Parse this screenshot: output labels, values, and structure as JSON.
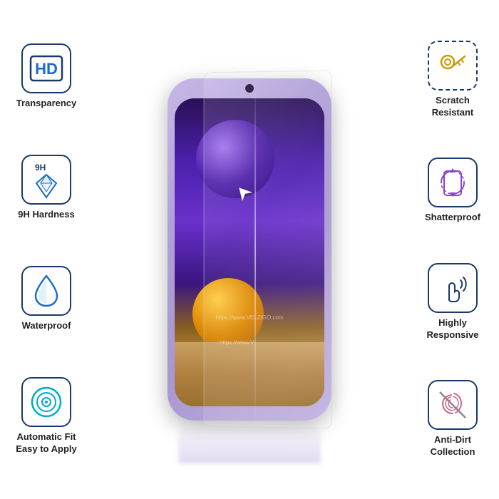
{
  "features": {
    "left": [
      {
        "id": "hd-transparency",
        "label": "Transparency",
        "icon": "hd",
        "sublabel": ""
      },
      {
        "id": "9h-hardness",
        "label": "9H Hardness",
        "icon": "diamond",
        "sublabel": "9H"
      },
      {
        "id": "waterproof",
        "label": "Waterproof",
        "icon": "drop"
      },
      {
        "id": "auto-fit",
        "label": "Automatic Fit\nEasy to Apply",
        "icon": "target",
        "line1": "Automatic Fit",
        "line2": "Easy to Apply"
      }
    ],
    "right": [
      {
        "id": "scratch-resistant",
        "label": "Scratch\nResistant",
        "icon": "key",
        "line1": "Scratch",
        "line2": "Resistant",
        "dashed": true
      },
      {
        "id": "shatterproof",
        "label": "Shatterproof",
        "icon": "rotate-phone"
      },
      {
        "id": "highly-responsive",
        "label": "Highly\nResponsive",
        "icon": "touch",
        "line1": "Highly",
        "line2": "Responsive"
      },
      {
        "id": "anti-dirt",
        "label": "Anti-Dirt\nCollection",
        "icon": "fingerprint",
        "line1": "Anti-Dirt",
        "line2": "Collection"
      }
    ]
  },
  "watermark": "https://www.VELZIGO.com",
  "watermark2": "https://www.V",
  "brand": "VELZIGO",
  "colors": {
    "border": "#1a3a6b",
    "text": "#222222",
    "accent_blue": "#1a6bcc",
    "accent_cyan": "#00aacc"
  }
}
